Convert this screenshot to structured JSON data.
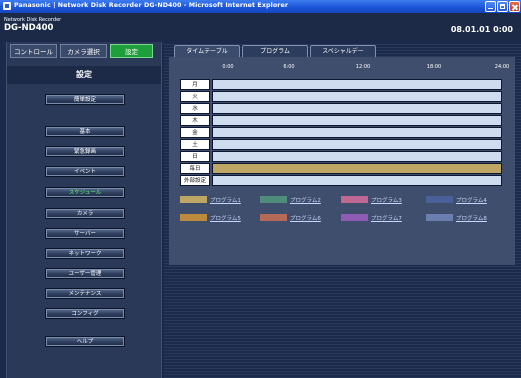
{
  "window": {
    "title": "Panasonic | Network Disk Recorder DG-ND400 - Microsoft Internet Explorer"
  },
  "header": {
    "subtitle": "Network Disk Recorder",
    "model": "DG-ND400",
    "datetime": "08.01.01  0:00"
  },
  "mode_tabs": [
    {
      "label": "コントロール",
      "active": false
    },
    {
      "label": "カメラ選択",
      "active": false
    },
    {
      "label": "設定",
      "active": true
    }
  ],
  "sidebar": {
    "title": "設定",
    "items": [
      {
        "label": "簡単設定",
        "active": false
      },
      {
        "label": "基本",
        "active": false
      },
      {
        "label": "緊急録画",
        "active": false
      },
      {
        "label": "イベント",
        "active": false
      },
      {
        "label": "スケジュール",
        "active": true
      },
      {
        "label": "カメラ",
        "active": false
      },
      {
        "label": "サーバー",
        "active": false
      },
      {
        "label": "ネットワーク",
        "active": false
      },
      {
        "label": "ユーザー管理",
        "active": false
      },
      {
        "label": "メンテナンス",
        "active": false
      },
      {
        "label": "コンフィグ",
        "active": false
      },
      {
        "label": "ヘルプ",
        "active": false
      }
    ]
  },
  "tabs": [
    {
      "label": "タイムテーブル",
      "active": true
    },
    {
      "label": "プログラム",
      "active": false
    },
    {
      "label": "スペシャルデー",
      "active": false
    }
  ],
  "timetable": {
    "time_labels": [
      "0:00",
      "6:00",
      "12:00",
      "18:00",
      "24:00"
    ],
    "rows": [
      {
        "label": "月",
        "program": null
      },
      {
        "label": "火",
        "program": null
      },
      {
        "label": "水",
        "program": null
      },
      {
        "label": "木",
        "program": null
      },
      {
        "label": "金",
        "program": null
      },
      {
        "label": "土",
        "program": null
      },
      {
        "label": "日",
        "program": null
      },
      {
        "label": "毎日",
        "program": "プログラム1"
      },
      {
        "label": "外部設定",
        "program": null
      }
    ]
  },
  "legend": [
    {
      "label": "プログラム1",
      "color": "#bea764"
    },
    {
      "label": "プログラム2",
      "color": "#4f8c7c"
    },
    {
      "label": "プログラム3",
      "color": "#bf6893"
    },
    {
      "label": "プログラム4",
      "color": "#4b5f99"
    },
    {
      "label": "プログラム5",
      "color": "#be8a3e"
    },
    {
      "label": "プログラム6",
      "color": "#b56a57"
    },
    {
      "label": "プログラム7",
      "color": "#8e5cb3"
    },
    {
      "label": "プログラム8",
      "color": "#6a7fb0"
    }
  ]
}
